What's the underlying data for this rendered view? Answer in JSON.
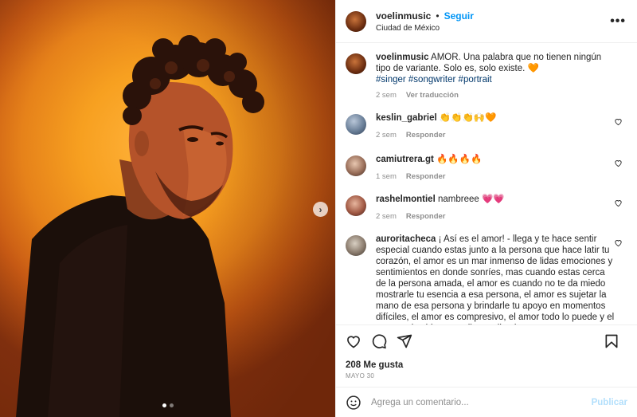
{
  "photo": {
    "alt_icon": "man-portrait-photo",
    "carousel_dots": 2,
    "active_dot": 0,
    "next_icon": "chevron-right-icon"
  },
  "header": {
    "username": "voelinmusic",
    "separator": "•",
    "follow_label": "Seguir",
    "location": "Ciudad de México",
    "more_icon": "more-options-icon"
  },
  "caption": {
    "username": "voelinmusic",
    "text": "AMOR. Una palabra que no tienen ningún tipo de variante. Solo es, solo existe. 🧡",
    "hashtags": "#singer #songwriter #portrait",
    "time": "2 sem",
    "translate_label": "Ver traducción"
  },
  "comments": [
    {
      "username": "keslin_gabriel",
      "text": "👏👏👏🙌🧡",
      "time": "2 sem",
      "reply_label": "Responder"
    },
    {
      "username": "camiutrera.gt",
      "text": "🔥🔥🔥🔥",
      "time": "1 sem",
      "reply_label": "Responder"
    },
    {
      "username": "rashelmontiel",
      "text": "nambreee 💗💗",
      "time": "2 sem",
      "reply_label": "Responder"
    },
    {
      "username": "auroritacheca",
      "text": "¡ Así es el amor! - llega y te hace sentir especial cuando estas junto a la persona que hace latir tu corazón, el amor es un mar inmenso de lidas emociones y sentimientos en donde sonríes, mas cuando estas cerca de la persona amada, el amor es cuando no te da miedo mostrarle tu esencia a esa persona, el amor es sujetar la mano de esa persona y brindarle tu apoyo en momentos difíciles, el amor es compresivo, el amor todo lo puede y el amor es la chispa que llega a iluminar"
    }
  ],
  "footer": {
    "likes": "208 Me gusta",
    "date": "MAYO 30",
    "comment_placeholder": "Agrega un comentario...",
    "publish_label": "Publicar"
  },
  "colors": {
    "accent": "#0095f6",
    "publish_disabled": "#b2dffc",
    "muted": "#8e8e8e",
    "text": "#262626"
  }
}
